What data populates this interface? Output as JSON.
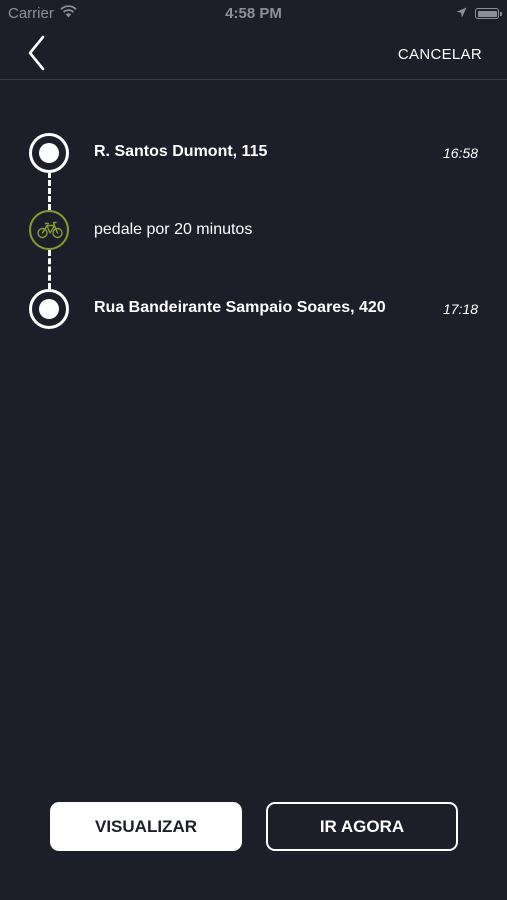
{
  "status_bar": {
    "carrier": "Carrier",
    "time": "4:58 PM"
  },
  "nav": {
    "back_icon": "chevron-left-icon",
    "cancel_label": "CANCELAR"
  },
  "route": {
    "origin": {
      "name": "R. Santos Dumont, 115",
      "time": "16:58"
    },
    "segment": {
      "icon": "bicycle-icon",
      "text": "pedale por 20 minutos",
      "accent_color": "#8a9a2e"
    },
    "destination": {
      "name": "Rua Bandeirante Sampaio Soares, 420",
      "time": "17:18"
    }
  },
  "actions": {
    "view_label": "VISUALIZAR",
    "go_label": "IR AGORA"
  },
  "colors": {
    "background": "#1c1f2a",
    "text": "#ffffff"
  }
}
